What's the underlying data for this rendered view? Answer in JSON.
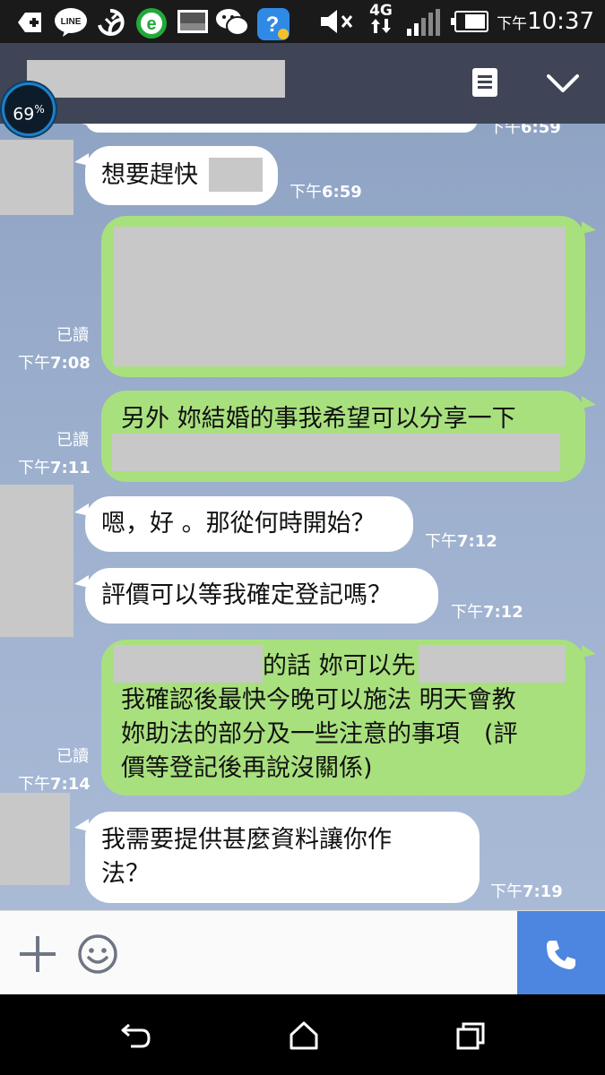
{
  "status_bar": {
    "time_prefix": "下午",
    "time": "10:37",
    "network": "4G",
    "icons": [
      "add-icon",
      "line-app-icon",
      "sync-icon",
      "browser-icon",
      "image-icon",
      "wechat-icon",
      "help-app-icon",
      "mute-icon",
      "4g-icon",
      "signal-icon",
      "battery-icon"
    ]
  },
  "header": {
    "title": "",
    "icons": [
      "menu-icon",
      "chevron-down-icon"
    ]
  },
  "battery_widget": {
    "value": "69",
    "unit": "%"
  },
  "messages": [
    {
      "id": "m0",
      "direction": "in",
      "text": "",
      "time_prefix": "下午",
      "time": "6:59"
    },
    {
      "id": "m1",
      "direction": "in",
      "text": "想要趕快",
      "time_prefix": "下午",
      "time": "6:59"
    },
    {
      "id": "m2",
      "direction": "out",
      "read": "已讀",
      "time_prefix": "下午",
      "time": "7:08"
    },
    {
      "id": "m3",
      "direction": "out",
      "text": "另外 妳結婚的事我希望可以分享一下",
      "read": "已讀",
      "time_prefix": "下午",
      "time": "7:11"
    },
    {
      "id": "m4",
      "direction": "in",
      "text": "嗯，好 。那從何時開始？",
      "time_prefix": "下午",
      "time": "7:12"
    },
    {
      "id": "m5",
      "direction": "in",
      "text": "評價可以等我確定登記嗎？",
      "time_prefix": "下午",
      "time": "7:12"
    },
    {
      "id": "m6",
      "direction": "out",
      "lines": [
        "的話 妳可以先",
        "我確認後最快今晚可以施法 明天會教",
        "妳助法的部分及一些注意的事項　(評",
        "價等登記後再說沒關係)"
      ],
      "read": "已讀",
      "time_prefix": "下午",
      "time": "7:14"
    },
    {
      "id": "m7",
      "direction": "in",
      "lines": [
        "我需要提供甚麼資料讓你作",
        "法？"
      ],
      "time_prefix": "下午",
      "time": "7:19"
    }
  ],
  "input_bar": {
    "icons": [
      "plus-icon",
      "emoji-icon",
      "phone-icon"
    ]
  },
  "nav_bar": {
    "icons": [
      "back-icon",
      "home-icon",
      "recents-icon"
    ]
  },
  "colors": {
    "status_bar": "#1a1a1a",
    "header": "#3f4556",
    "chat_background": "#9db0ce",
    "outgoing_bubble": "#a9e07e",
    "incoming_bubble": "#ffffff",
    "call_button": "#4d86e0"
  }
}
